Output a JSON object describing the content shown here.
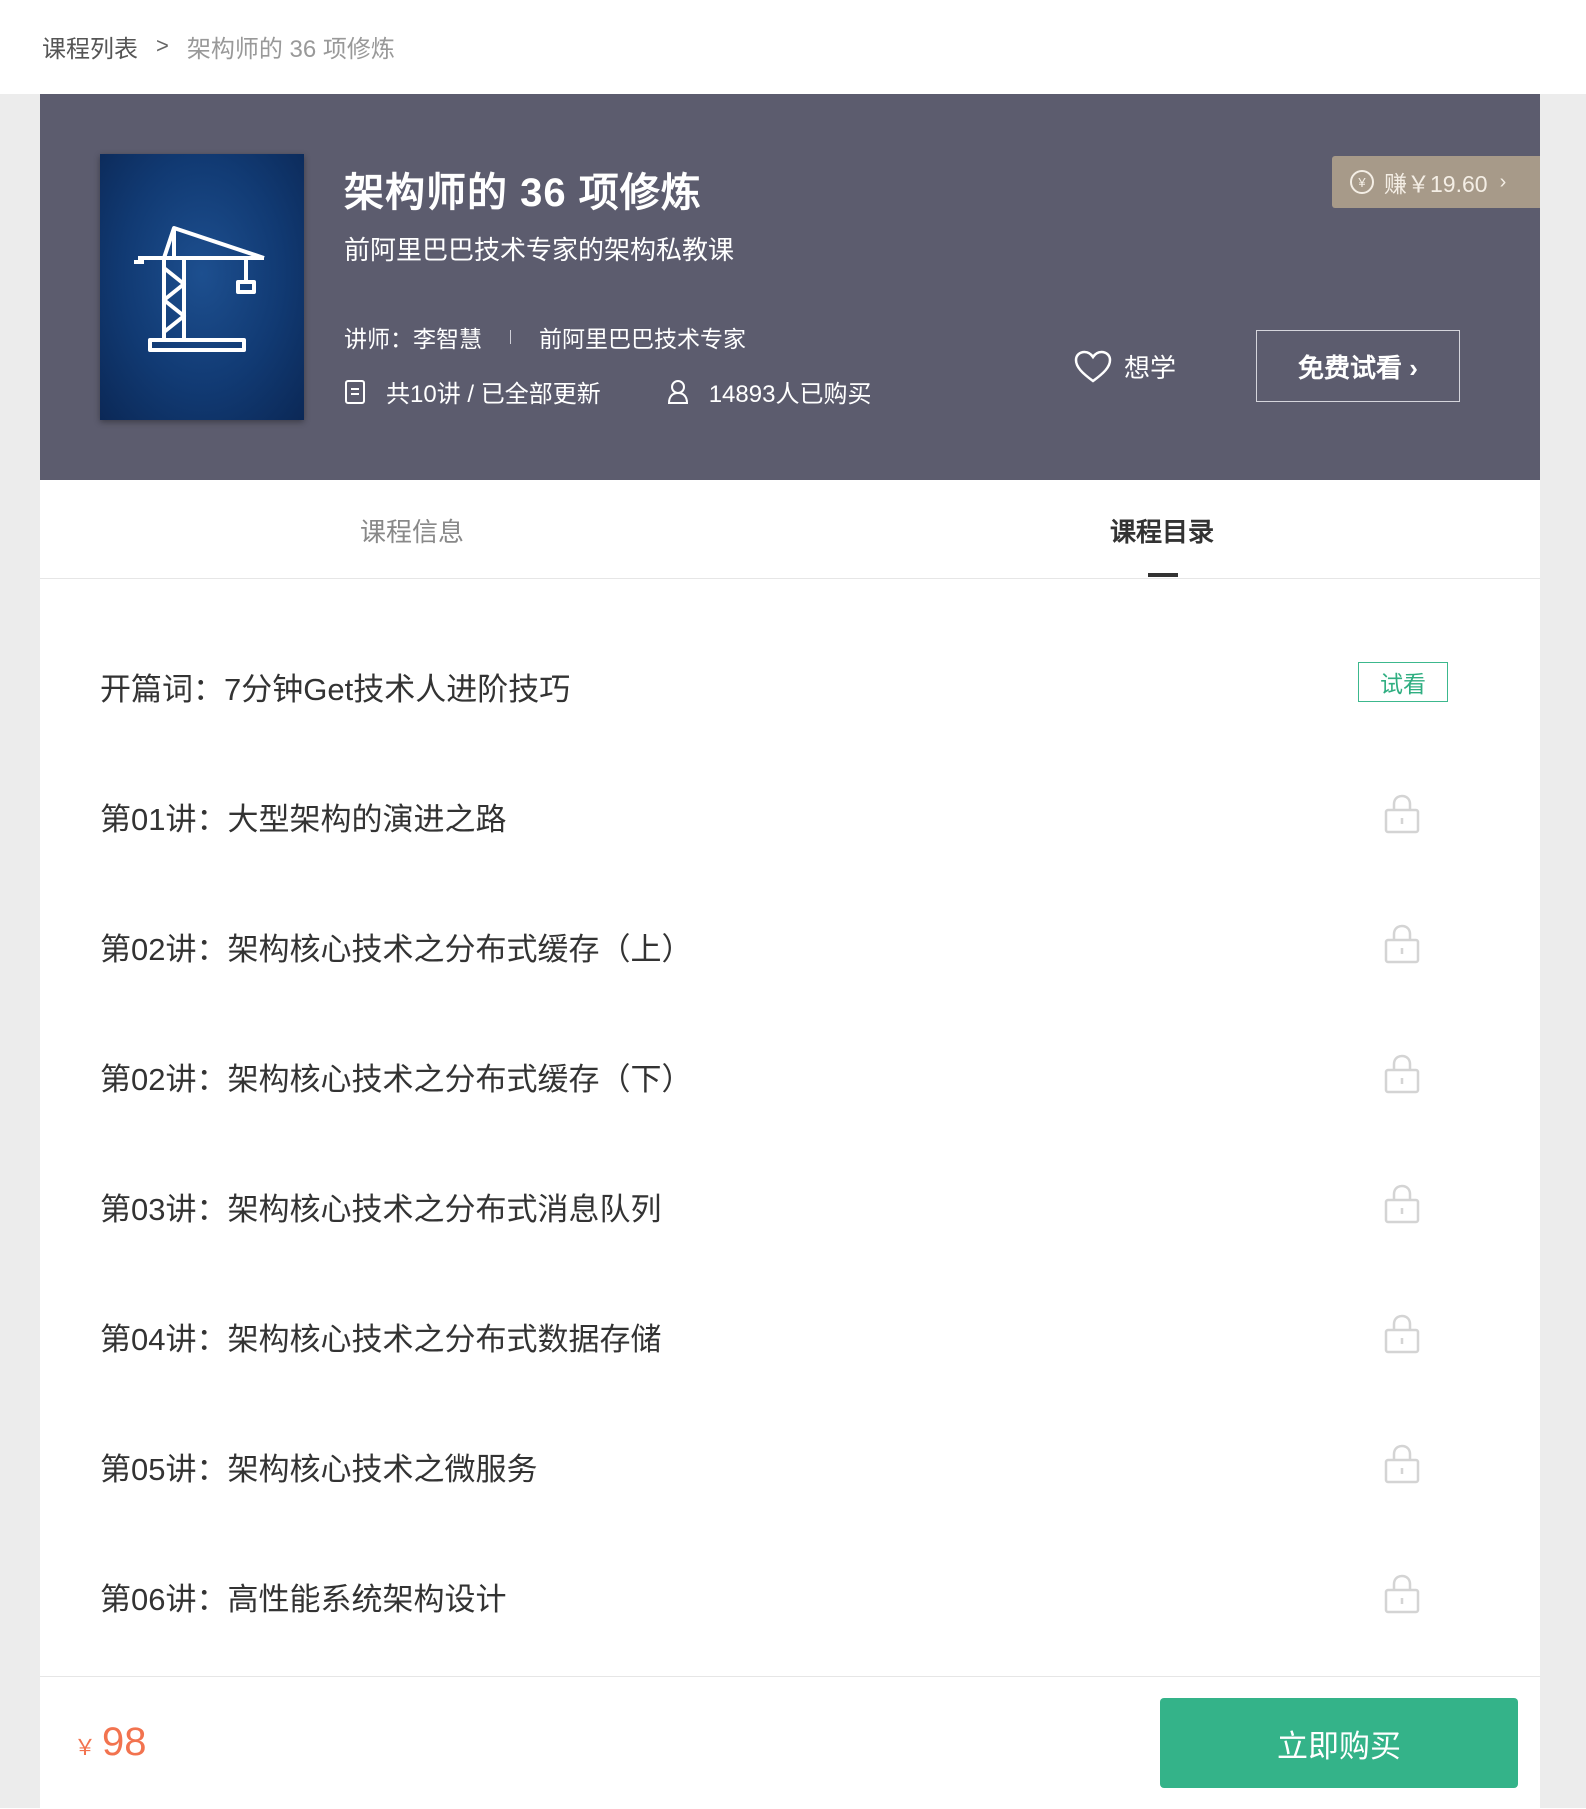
{
  "breadcrumb": {
    "parent": "课程列表",
    "separator": ">",
    "current": "架构师的 36 项修炼"
  },
  "course": {
    "title": "架构师的 36 项修炼",
    "subtitle": "前阿里巴巴技术专家的架构私教课",
    "teacher": "讲师：李智慧",
    "teacher_title": "前阿里巴巴技术专家",
    "lessons_info": "共10讲 / 已全部更新",
    "buyers": "14893人已购买",
    "earn": "赚￥19.60",
    "want_label": "想学",
    "trial_label": "免费试看 ›"
  },
  "tabs": [
    {
      "label": "课程信息",
      "active": false
    },
    {
      "label": "课程目录",
      "active": true
    }
  ],
  "lessons": [
    {
      "title": "开篇词：7分钟Get技术人进阶技巧",
      "badge": "试看",
      "locked": false
    },
    {
      "title": "第01讲：大型架构的演进之路",
      "locked": true
    },
    {
      "title": "第02讲：架构核心技术之分布式缓存（上）",
      "locked": true
    },
    {
      "title": "第02讲：架构核心技术之分布式缓存（下）",
      "locked": true
    },
    {
      "title": "第03讲：架构核心技术之分布式消息队列",
      "locked": true
    },
    {
      "title": "第04讲：架构核心技术之分布式数据存储",
      "locked": true
    },
    {
      "title": "第05讲：架构核心技术之微服务",
      "locked": true
    },
    {
      "title": "第06讲：高性能系统架构设计",
      "locked": true
    }
  ],
  "footer": {
    "currency": "￥",
    "price": "98",
    "buy_label": "立即购买"
  },
  "colors": {
    "hero_bg": "#5c5c6e",
    "accent_green": "#34b389",
    "price_orange": "#f2734f",
    "earn_badge": "#a79a89"
  },
  "icons": {
    "cover": "crane-icon",
    "earn": "yuan-coin-icon",
    "want": "heart-icon",
    "lessons": "document-icon",
    "buyers": "user-icon",
    "lock": "lock-icon"
  }
}
